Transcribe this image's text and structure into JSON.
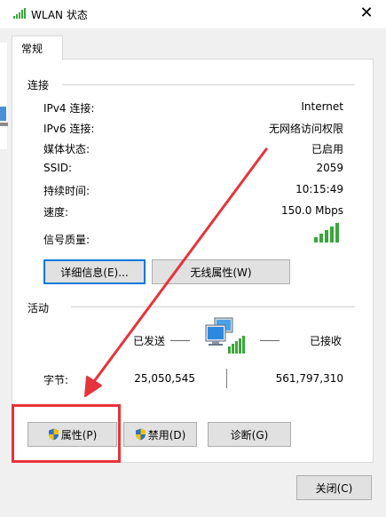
{
  "window": {
    "title": "WLAN 状态"
  },
  "tabs": [
    {
      "label": "常规"
    }
  ],
  "connection": {
    "section_title": "连接",
    "rows": [
      {
        "label": "IPv4 连接:",
        "value": "Internet"
      },
      {
        "label": "IPv6 连接:",
        "value": "无网络访问权限"
      },
      {
        "label": "媒体状态:",
        "value": "已启用"
      },
      {
        "label": "SSID:",
        "value": "2059"
      },
      {
        "label": "持续时间:",
        "value": "10:15:49"
      },
      {
        "label": "速度:",
        "value": "150.0 Mbps"
      }
    ],
    "signal_label": "信号质量:",
    "signal_bars": 5,
    "signal_bars_active": 5,
    "details_button": "详细信息(E)...",
    "wireless_props_button": "无线属性(W)"
  },
  "activity": {
    "section_title": "活动",
    "sent_label": "已发送",
    "received_label": "已接收",
    "bytes_label": "字节:",
    "bytes_sent": "25,050,545",
    "bytes_received": "561,797,310"
  },
  "actions": {
    "properties_button": "属性(P)",
    "disable_button": "禁用(D)",
    "diagnose_button": "诊断(G)"
  },
  "footer": {
    "close_button": "关闭(C)"
  },
  "colors": {
    "signal_green": "#3aa63a",
    "annotation_red": "#e8333a",
    "focus_blue": "#0078d7",
    "shield_blue": "#2f6fc9",
    "shield_yellow": "#f2c200"
  }
}
